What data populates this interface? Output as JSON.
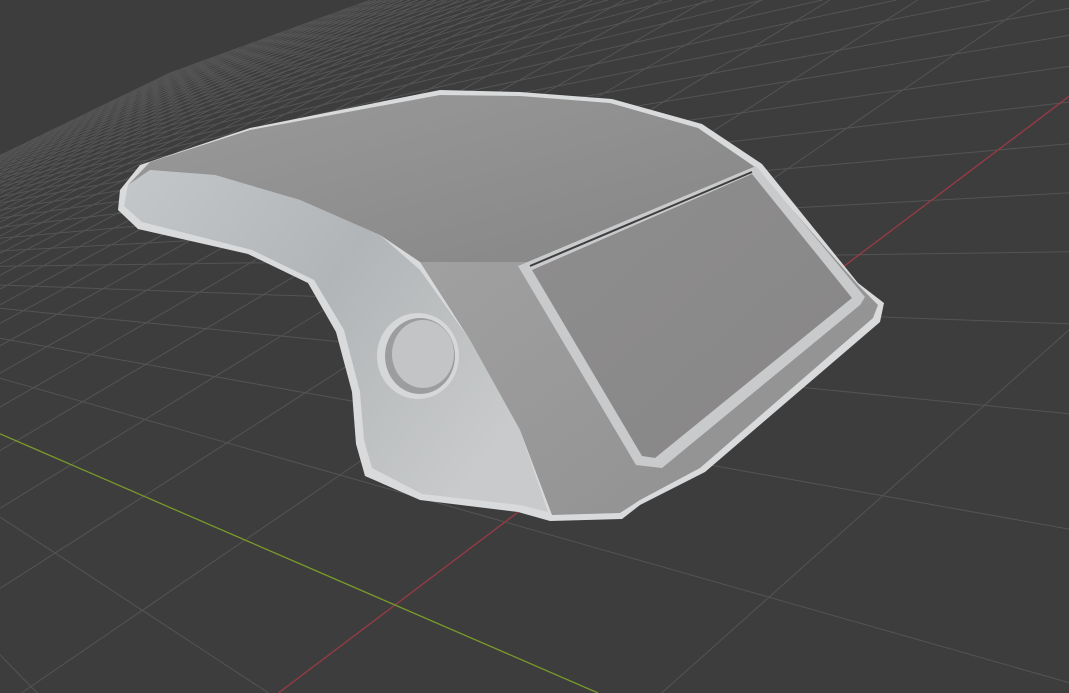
{
  "viewport": {
    "background_color": "#3d3d3d",
    "grid_color": "#545454",
    "x_axis_color": "#9a3a45",
    "y_axis_color": "#7a9a2a"
  },
  "model": {
    "top_color": "#8d8d8d",
    "side_color": "#b9bcbe",
    "window_color": "#8a8989"
  }
}
